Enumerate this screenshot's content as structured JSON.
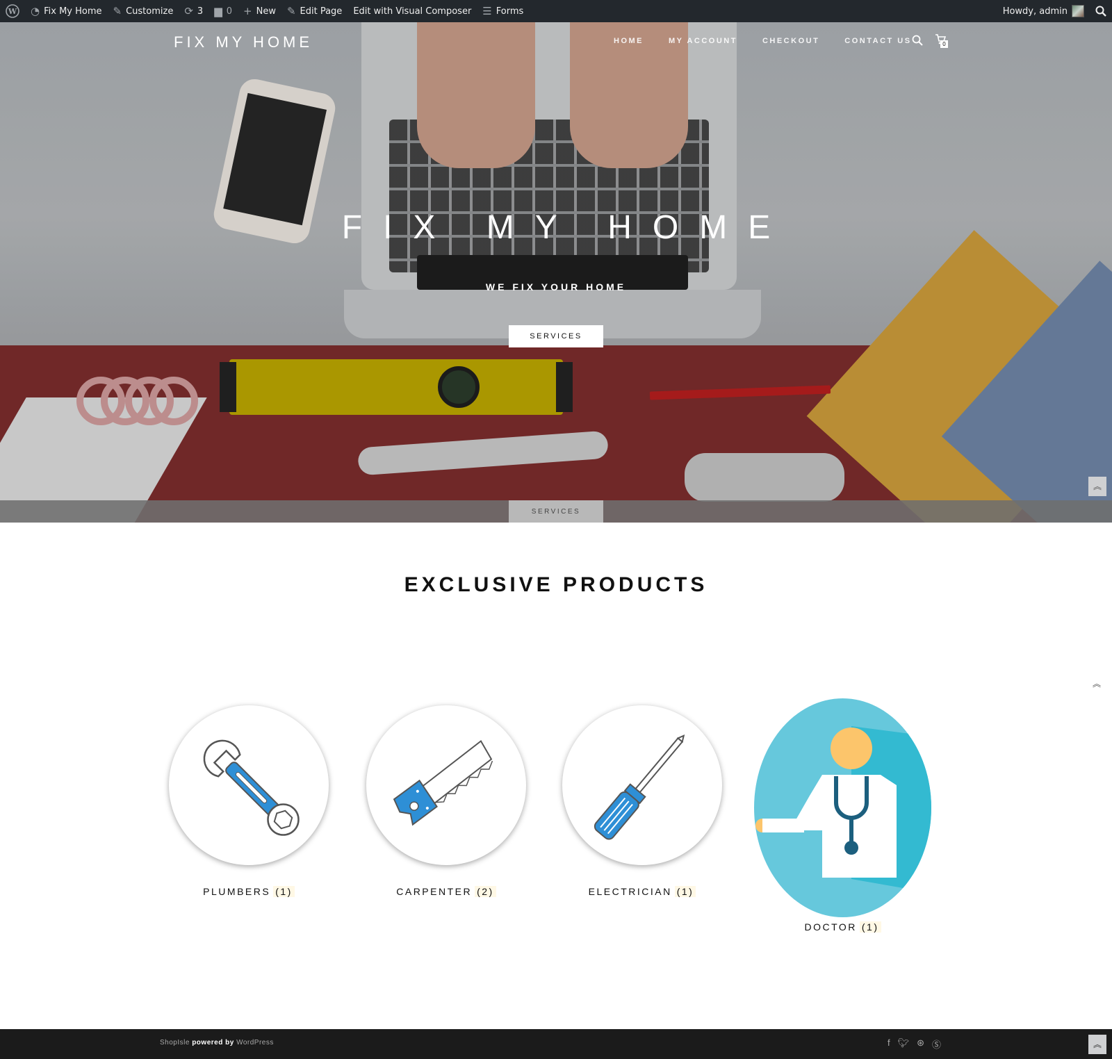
{
  "adminbar": {
    "site_name": "Fix My Home",
    "customize": "Customize",
    "updates_count": "3",
    "comments_count": "0",
    "new_label": "New",
    "edit_page": "Edit Page",
    "edit_vc": "Edit with Visual Composer",
    "forms": "Forms",
    "howdy": "Howdy, admin"
  },
  "header": {
    "brand": "FIX MY HOME",
    "nav": [
      "HOME",
      "MY ACCOUNT",
      "CHECKOUT",
      "CONTACT US"
    ],
    "cart_count": "0"
  },
  "hero": {
    "title": "FIX MY HOME",
    "subtitle": "WE FIX YOUR HOME",
    "button": "SERVICES",
    "bottom_button": "SERVICES"
  },
  "products": {
    "title": "EXCLUSIVE PRODUCTS",
    "categories": [
      {
        "name": "PLUMBERS",
        "count": "(1)",
        "icon": "wrench-icon"
      },
      {
        "name": "CARPENTER",
        "count": "(2)",
        "icon": "saw-icon"
      },
      {
        "name": "ELECTRICIAN",
        "count": "(1)",
        "icon": "screwdriver-icon"
      },
      {
        "name": "DOCTOR",
        "count": "(1)",
        "icon": "doctor-icon"
      }
    ]
  },
  "footer": {
    "theme": "ShopIsle",
    "powered": "powered by",
    "platform": "WordPress",
    "social": [
      "facebook-icon",
      "twitter-icon",
      "dribbble-icon",
      "skype-icon"
    ]
  },
  "colors": {
    "adminbar": "#23282d",
    "footer": "#1b1b1b",
    "icon_blue": "#2e8fd6",
    "doctor_bg": "#66c8dc"
  }
}
